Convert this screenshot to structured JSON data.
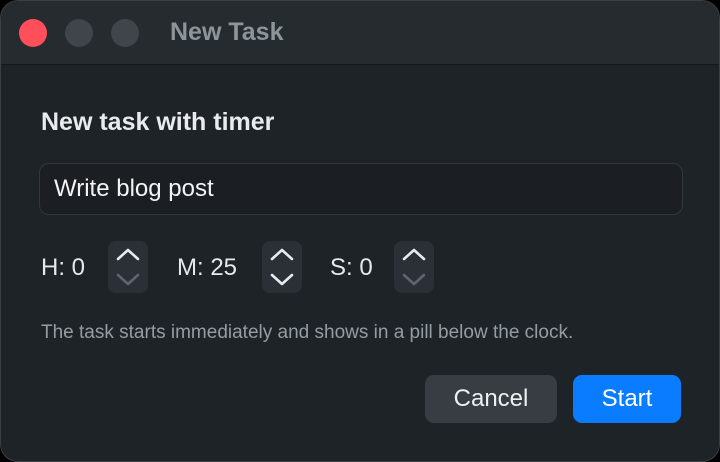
{
  "window": {
    "title": "New Task"
  },
  "dialog": {
    "heading": "New task with timer",
    "task_name_value": "Write blog post",
    "hint": "The task starts immediately and shows in a pill below the clock."
  },
  "timer": {
    "hours_label": "H: 0",
    "minutes_label": "M: 25",
    "seconds_label": "S: 0"
  },
  "buttons": {
    "cancel_label": "Cancel",
    "start_label": "Start"
  },
  "colors": {
    "accent": "#0a7cff",
    "close_light": "#ff4f5a",
    "background": "#1e2328"
  }
}
